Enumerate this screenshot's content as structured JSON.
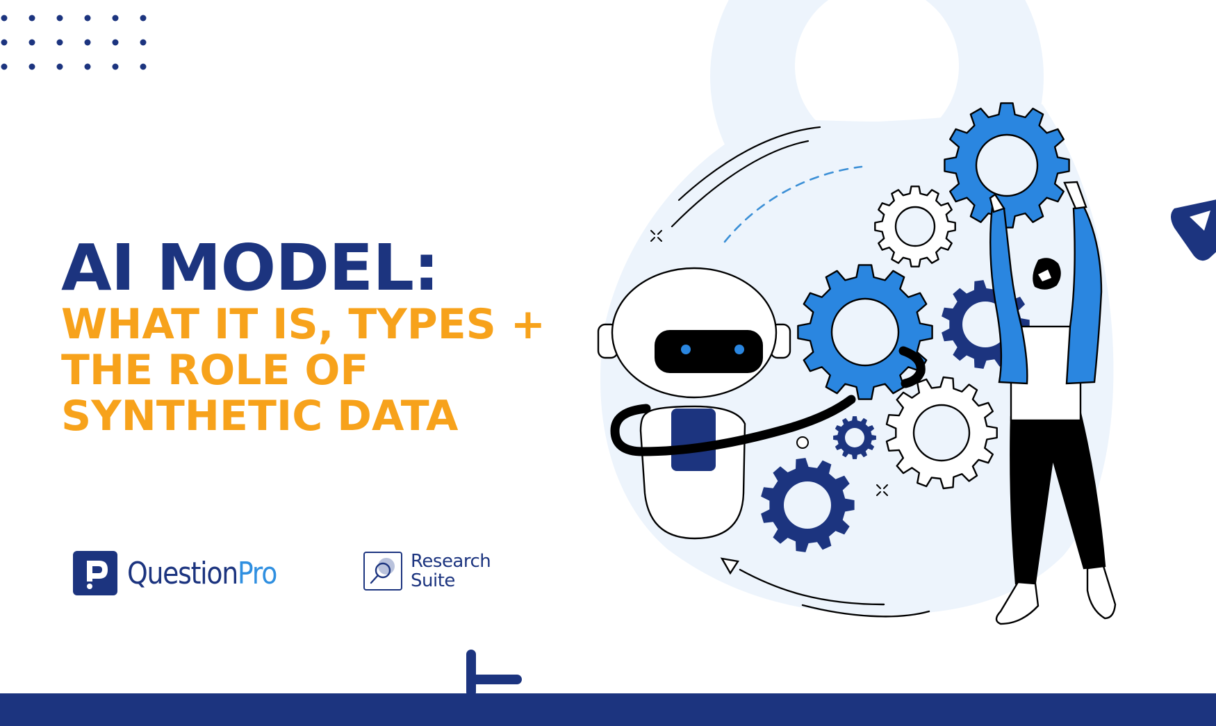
{
  "title": {
    "main": "AI MODEL:",
    "subtitle_lines": [
      "WHAT IT IS, TYPES +",
      "THE ROLE OF",
      "SYNTHETIC DATA"
    ]
  },
  "logos": {
    "questionpro": {
      "name_part1": "Question",
      "name_part2": "Pro",
      "icon": "questionpro-logo-icon"
    },
    "research_suite": {
      "line1": "Research",
      "line2": "Suite",
      "icon": "magnifier-icon"
    }
  },
  "illustration": {
    "subjects": [
      "robot",
      "gears",
      "person-holding-gear"
    ],
    "icons": [
      "robot-icon",
      "gear-icon",
      "person-icon",
      "play-triangle-icon",
      "plus-icon",
      "dot-grid-icon",
      "sparkle-icon",
      "arrow-icon"
    ]
  },
  "colors": {
    "brand_navy": "#1c347f",
    "accent_orange": "#f7a21b",
    "accent_blue": "#2a86e0",
    "pale_blue": "#edf4fc",
    "ink": "#000000"
  }
}
